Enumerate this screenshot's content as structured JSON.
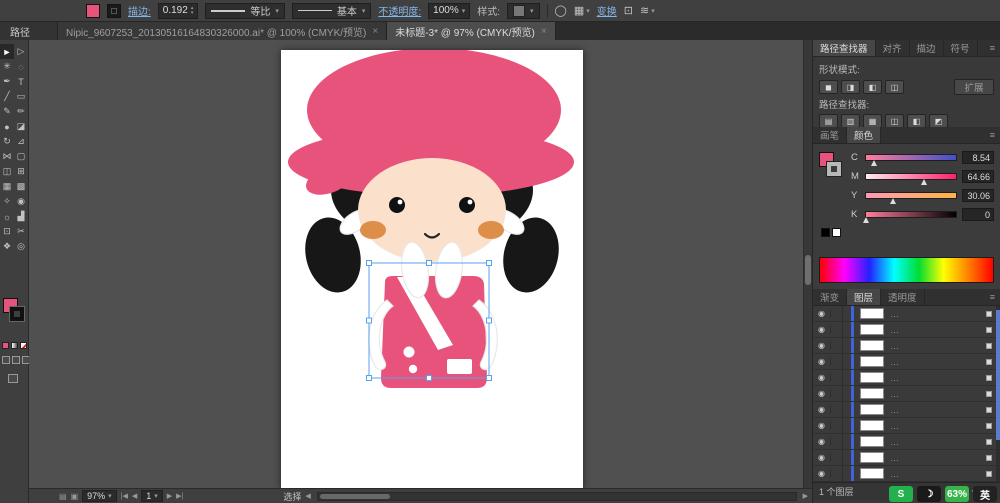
{
  "glyphs": {
    "caret": "▾",
    "step_up": "▴",
    "step_down": "▾",
    "close": "×",
    "menu": "≡",
    "eye": "◉",
    "left_end": "|◀",
    "left": "◀",
    "right": "▶",
    "right_end": "▶|",
    "ellipsis": "…"
  },
  "topbar": {
    "stroke_label": "描边:",
    "stroke_weight": "0.192",
    "profile_value": "等比",
    "brush_value": "基本",
    "opacity_label": "不透明度:",
    "opacity_value": "100%",
    "style_label": "样式:",
    "transform_label": "变换",
    "icons": {
      "doc_setup": "◯",
      "grid": "▦",
      "free_transform": "⊡",
      "arrange": "≋"
    }
  },
  "path_label": "路径",
  "doc_tabs": [
    {
      "title": "Nipic_9607253_20130516164830326000.ai* @ 100% (CMYK/预览)"
    },
    {
      "title": "未标题-3* @ 97% (CMYK/预览)"
    }
  ],
  "tools": [
    {
      "name": "selection-tool",
      "glyph": "►"
    },
    {
      "name": "direct-selection-tool",
      "glyph": "▷"
    },
    {
      "name": "magic-wand-tool",
      "glyph": "✳"
    },
    {
      "name": "lasso-tool",
      "glyph": "◌"
    },
    {
      "name": "pen-tool",
      "glyph": "✒"
    },
    {
      "name": "type-tool",
      "glyph": "T"
    },
    {
      "name": "line-segment-tool",
      "glyph": "╱"
    },
    {
      "name": "rectangle-tool",
      "glyph": "▭"
    },
    {
      "name": "paintbrush-tool",
      "glyph": "✎"
    },
    {
      "name": "pencil-tool",
      "glyph": "✏"
    },
    {
      "name": "blob-brush-tool",
      "glyph": "●"
    },
    {
      "name": "eraser-tool",
      "glyph": "◪"
    },
    {
      "name": "rotate-tool",
      "glyph": "↻"
    },
    {
      "name": "scale-tool",
      "glyph": "⊿"
    },
    {
      "name": "width-tool",
      "glyph": "⋈"
    },
    {
      "name": "free-transform-tool",
      "glyph": "▢"
    },
    {
      "name": "shape-builder-tool",
      "glyph": "◫"
    },
    {
      "name": "perspective-grid-tool",
      "glyph": "⊞"
    },
    {
      "name": "mesh-tool",
      "glyph": "▦"
    },
    {
      "name": "gradient-tool",
      "glyph": "▩"
    },
    {
      "name": "eyedropper-tool",
      "glyph": "✧"
    },
    {
      "name": "blend-tool",
      "glyph": "◉"
    },
    {
      "name": "symbol-sprayer-tool",
      "glyph": "☼"
    },
    {
      "name": "column-graph-tool",
      "glyph": "▟"
    },
    {
      "name": "artboard-tool",
      "glyph": "⊡"
    },
    {
      "name": "slice-tool",
      "glyph": "✂"
    },
    {
      "name": "hand-tool",
      "glyph": "❖"
    },
    {
      "name": "zoom-tool",
      "glyph": "◎"
    }
  ],
  "right_panel": {
    "top_tabs": [
      {
        "label": "路径查找器",
        "active": true
      },
      {
        "label": "对齐",
        "active": false
      },
      {
        "label": "描边",
        "active": false
      },
      {
        "label": "符号",
        "active": false
      }
    ],
    "shape_modes_label": "形状模式:",
    "shape_mode_icons": [
      "◼",
      "◨",
      "◧",
      "◫"
    ],
    "expand_button": "扩展",
    "pathfinder_label": "路径查找器:",
    "pathfinder_icons": [
      "▤",
      "▥",
      "▦",
      "◫",
      "◧",
      "◩"
    ],
    "color_tabs": [
      {
        "label": "画笔",
        "active": false
      },
      {
        "label": "颜色",
        "active": true
      }
    ],
    "cmyk": [
      {
        "channel": "C",
        "value": "8.54"
      },
      {
        "channel": "M",
        "value": "64.66"
      },
      {
        "channel": "Y",
        "value": "30.06"
      },
      {
        "channel": "K",
        "value": "0"
      }
    ],
    "bottom_tabs": [
      {
        "label": "渐变",
        "active": false
      },
      {
        "label": "图层",
        "active": true
      },
      {
        "label": "透明度",
        "active": false
      }
    ],
    "layers": {
      "rows": 11,
      "count_label": "1 个图层",
      "icons": [
        {
          "name": "clipping-mask-icon",
          "glyph": "⊞"
        },
        {
          "name": "new-layer-icon",
          "glyph": "✚"
        },
        {
          "name": "delete-layer-icon",
          "glyph": "▭"
        }
      ]
    }
  },
  "statusbar": {
    "icons": [
      "▤",
      "▣"
    ],
    "zoom": "97%",
    "artboard_number": "1",
    "status_text": "选择"
  },
  "taskbar": [
    {
      "name": "sogou-icon",
      "text": "S",
      "bg": "#22b14c",
      "fg": "#ffffff"
    },
    {
      "name": "moon-icon",
      "text": "☽",
      "bg": "#1a1a1a",
      "fg": "#ffffff"
    },
    {
      "name": "battery-badge",
      "text": "63%",
      "bg": "#36b44a",
      "fg": "#ffffff"
    },
    {
      "name": "lang-indicator",
      "text": "英",
      "bg": "#222222",
      "fg": "#ffffff"
    }
  ],
  "artwork": {
    "hat_color": "#e8537c",
    "dress_color": "#e8537c",
    "skin_color": "#fbe1cb",
    "cheek_color": "#dd8f4a",
    "hair_color": "#171717",
    "selection_color": "#5aa0f0"
  }
}
